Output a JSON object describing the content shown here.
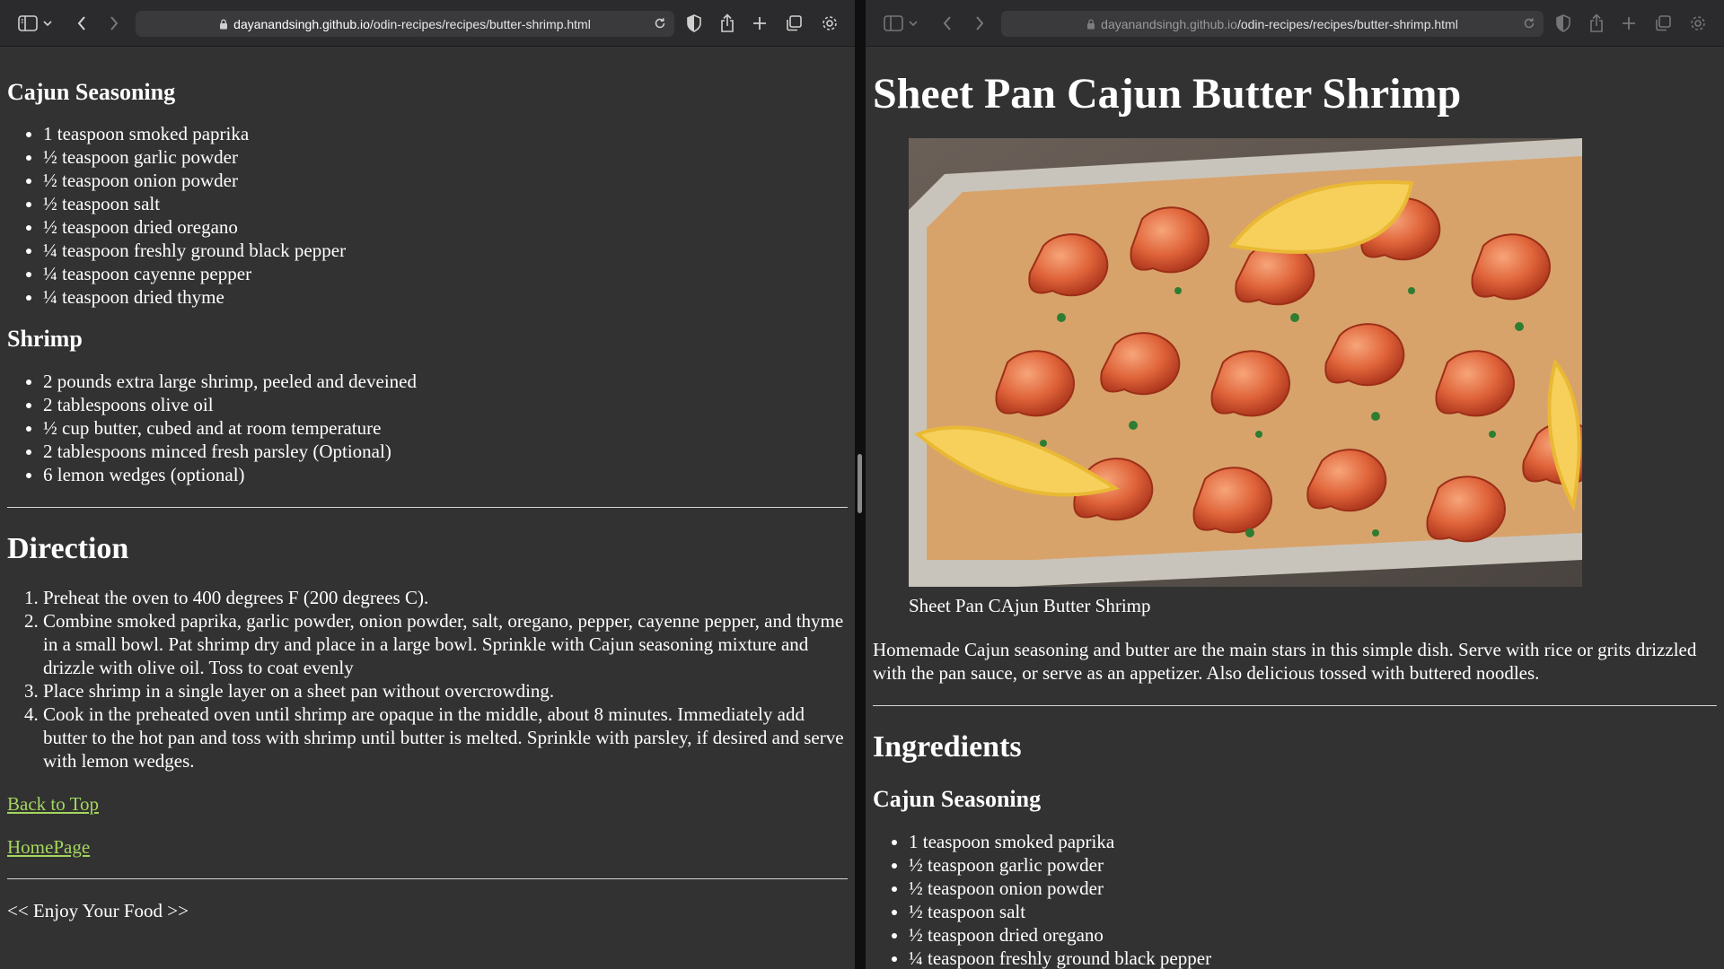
{
  "browser": {
    "url_host": "dayanandsingh.github.io",
    "url_path": "/odin-recipes/recipes/butter-shrimp.html"
  },
  "left": {
    "cajun_heading": "Cajun Seasoning",
    "cajun_items": [
      "1 teaspoon smoked paprika",
      "½ teaspoon garlic powder",
      "½ teaspoon onion powder",
      "½ teaspoon salt",
      "½ teaspoon dried oregano",
      "¼ teaspoon freshly ground black pepper",
      "¼ teaspoon cayenne pepper",
      "¼ teaspoon dried thyme"
    ],
    "shrimp_heading": "Shrimp",
    "shrimp_items": [
      "2 pounds extra large shrimp, peeled and deveined",
      "2 tablespoons olive oil",
      "½ cup butter, cubed and at room temperature",
      "2 tablespoons minced fresh parsley (Optional)",
      "6 lemon wedges (optional)"
    ],
    "direction_heading": "Direction",
    "directions": [
      "Preheat the oven to 400 degrees F (200 degrees C).",
      "Combine smoked paprika, garlic powder, onion powder, salt, oregano, pepper, cayenne pepper, and thyme in a small bowl. Pat shrimp dry and place in a large bowl. Sprinkle with Cajun seasoning mixture and drizzle with olive oil. Toss to coat evenly",
      "Place shrimp in a single layer on a sheet pan without overcrowding.",
      "Cook in the preheated oven until shrimp are opaque in the middle, about 8 minutes. Immediately add butter to the hot pan and toss with shrimp until butter is melted. Sprinkle with parsley, if desired and serve with lemon wedges."
    ],
    "back_to_top": "Back to Top",
    "homepage": "HomePage",
    "footer": "<< Enjoy Your Food >>"
  },
  "right": {
    "title": "Sheet Pan Cajun Butter Shrimp",
    "image_caption": "Sheet Pan CAjun Butter Shrimp",
    "intro": "Homemade Cajun seasoning and butter are the main stars in this simple dish. Serve with rice or grits drizzled with the pan sauce, or serve as an appetizer. Also delicious tossed with buttered noodles.",
    "ingredients_heading": "Ingredients",
    "cajun_heading": "Cajun Seasoning",
    "cajun_items": [
      "1 teaspoon smoked paprika",
      "½ teaspoon garlic powder",
      "½ teaspoon onion powder",
      "½ teaspoon salt",
      "½ teaspoon dried oregano",
      "¼ teaspoon freshly ground black pepper"
    ]
  },
  "colors": {
    "page_bg": "#323232",
    "link": "#a4d65e",
    "toolbar_bg": "#2b2b2d"
  }
}
